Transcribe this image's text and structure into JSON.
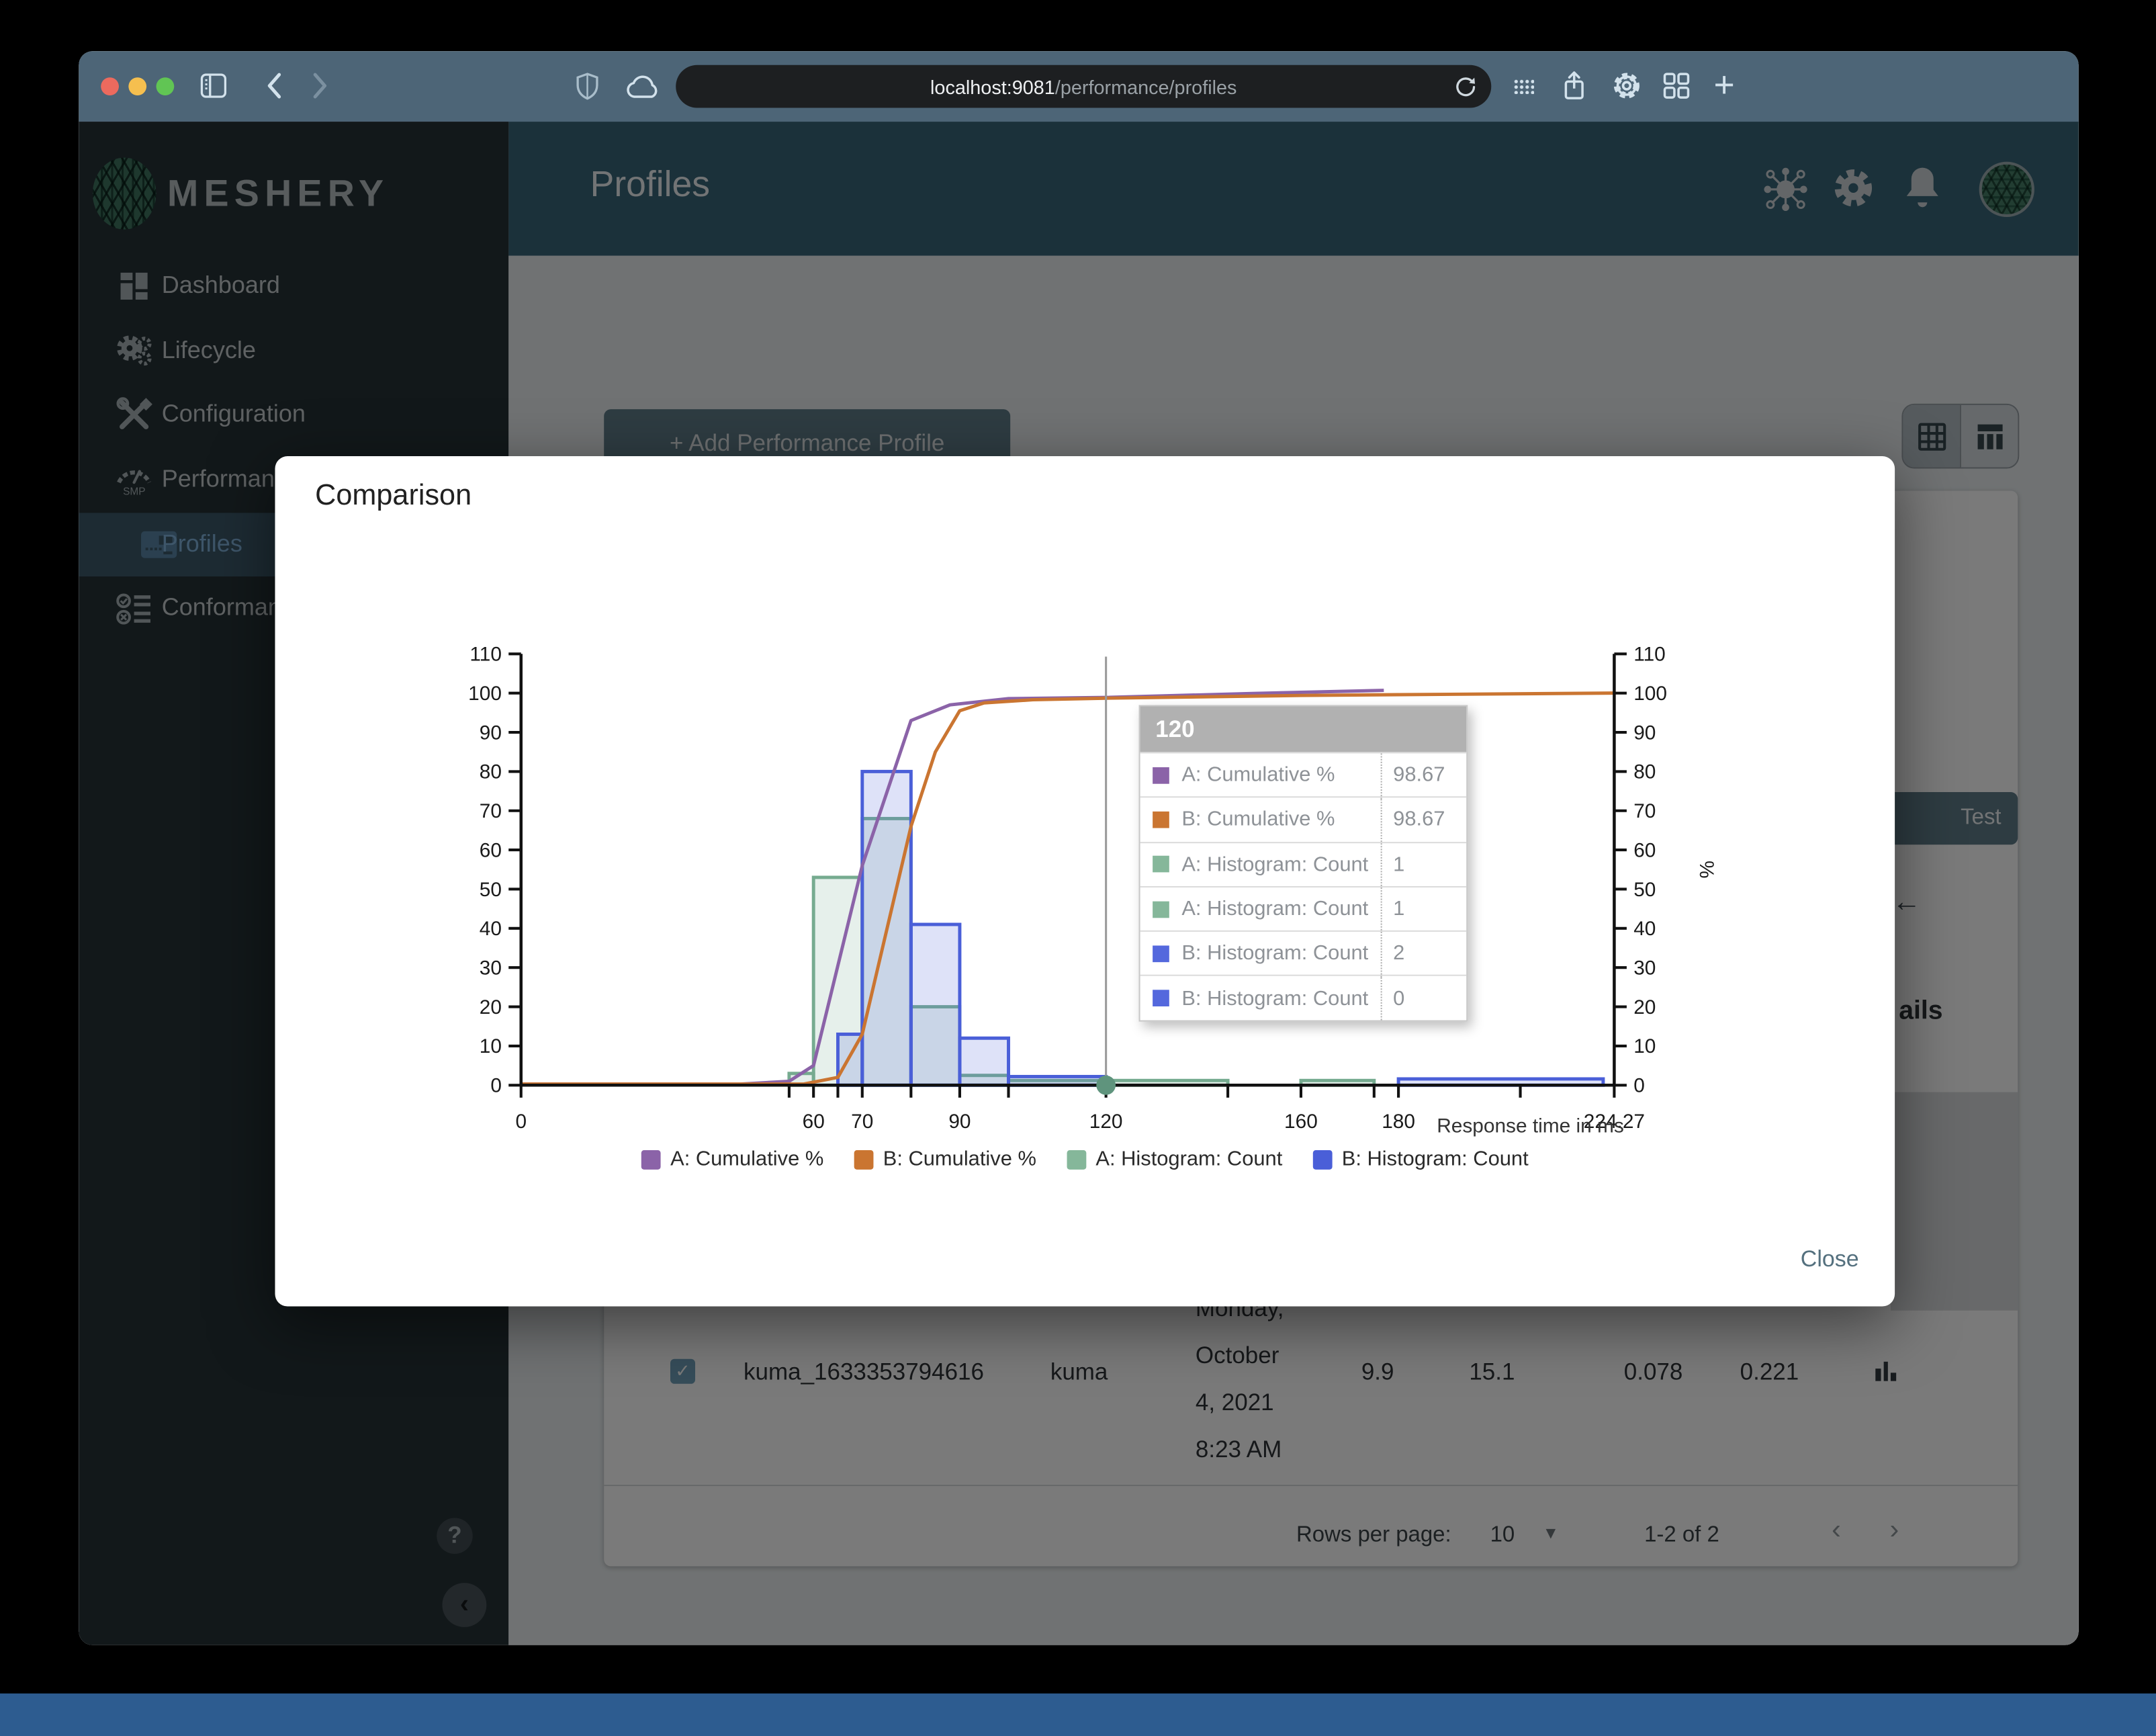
{
  "colors": {
    "toolbar": "#4d6577",
    "header": "#396679",
    "sidebar": "#263238",
    "accent_button": "#607d8b",
    "desktop": "#2d5c90",
    "traffic_red": "#ec6a5e",
    "traffic_yellow": "#f5bf4f",
    "traffic_green": "#61c554"
  },
  "browser": {
    "url_host": "localhost:9081",
    "url_path": "/performance/profiles"
  },
  "app": {
    "brand": "MESHERY",
    "header": {
      "title": "Profiles"
    },
    "sidebar": {
      "items": [
        {
          "label": "Dashboard"
        },
        {
          "label": "Lifecycle"
        },
        {
          "label": "Configuration"
        },
        {
          "label": "Performance"
        },
        {
          "label": "Profiles"
        },
        {
          "label": "Conformance"
        }
      ]
    },
    "content": {
      "add_button_label": "+ Add Performance Profile",
      "run_test_fragment_label": "Test",
      "details_fragment_label": "ails",
      "table_row": {
        "name": "kuma_1633353794616",
        "mesh": "kuma",
        "date_lines": [
          "Monday,",
          "October",
          "4, 2021",
          "8:23 AM"
        ],
        "metrics": [
          "9.9",
          "15.1",
          "0.078",
          "0.221"
        ]
      },
      "pagination": {
        "rows_label": "Rows per page:",
        "rows_value": "10",
        "range": "1-2 of 2"
      }
    }
  },
  "modal": {
    "title": "Comparison",
    "close_label": "Close"
  },
  "chart_data": {
    "type": "combo",
    "xlabel": "Response time in ms",
    "x_range": [
      0,
      224.27
    ],
    "y_left_range": [
      0,
      110
    ],
    "y_right_range": [
      0,
      110
    ],
    "y_right_label": "%",
    "y_ticks": [
      0,
      10,
      20,
      30,
      40,
      50,
      60,
      70,
      80,
      90,
      100,
      110
    ],
    "x_ticks_minor": [
      0,
      55,
      60,
      65,
      70,
      80,
      90,
      100,
      120,
      145,
      160,
      175,
      180,
      205,
      224.27
    ],
    "x_ticks_labeled": [
      {
        "v": 0,
        "s": "0"
      },
      {
        "v": 60,
        "s": "60"
      },
      {
        "v": 70,
        "s": "70"
      },
      {
        "v": 90,
        "s": "90"
      },
      {
        "v": 120,
        "s": "120"
      },
      {
        "v": 160,
        "s": "160"
      },
      {
        "v": 180,
        "s": "180"
      },
      {
        "v": 224.27,
        "s": "224.27"
      }
    ],
    "series": [
      {
        "name": "A: Cumulative %",
        "kind": "line",
        "color": "#8b63a8",
        "points": [
          [
            0,
            0.3
          ],
          [
            45,
            0.3
          ],
          [
            55,
            1
          ],
          [
            60,
            5
          ],
          [
            70,
            56
          ],
          [
            80,
            93
          ],
          [
            88,
            97
          ],
          [
            100,
            98.6
          ],
          [
            120,
            98.9
          ],
          [
            150,
            99.9
          ],
          [
            177,
            100.7
          ]
        ]
      },
      {
        "name": "B: Cumulative %",
        "kind": "line",
        "color": "#ca7531",
        "points": [
          [
            0,
            0.3
          ],
          [
            58,
            0.3
          ],
          [
            65,
            2
          ],
          [
            70,
            13
          ],
          [
            80,
            66
          ],
          [
            85,
            85
          ],
          [
            90,
            95.5
          ],
          [
            95,
            97.5
          ],
          [
            105,
            98.3
          ],
          [
            120,
            98.7
          ],
          [
            160,
            99.4
          ],
          [
            180,
            99.6
          ],
          [
            224.27,
            100
          ]
        ]
      },
      {
        "name": "A: Histogram: Count",
        "kind": "histogram",
        "color": "#76ab90",
        "bins": [
          [
            55,
            60,
            3
          ],
          [
            60,
            70,
            53
          ],
          [
            70,
            80,
            68
          ],
          [
            80,
            90,
            20
          ],
          [
            90,
            100,
            2.5
          ],
          [
            100,
            120,
            1.2
          ],
          [
            120,
            145,
            1.2
          ],
          [
            160,
            175,
            1.2
          ]
        ]
      },
      {
        "name": "B: Histogram: Count",
        "kind": "histogram",
        "color": "#4a5fd8",
        "bins": [
          [
            65,
            70,
            13
          ],
          [
            70,
            80,
            80
          ],
          [
            80,
            90,
            41
          ],
          [
            90,
            100,
            12
          ],
          [
            100,
            120,
            2.2
          ],
          [
            180,
            222,
            1.6
          ]
        ]
      }
    ],
    "crosshair": {
      "x": 120,
      "dot_color": "#5f947d"
    },
    "tooltip": {
      "title": "120",
      "rows": [
        {
          "color": "#8b63a8",
          "label": "A: Cumulative %",
          "value": "98.67"
        },
        {
          "color": "#ca7531",
          "label": "B: Cumulative %",
          "value": "98.67"
        },
        {
          "color": "#85b79a",
          "label": "A: Histogram: Count",
          "value": "1"
        },
        {
          "color": "#85b79a",
          "label": "A: Histogram: Count",
          "value": "1"
        },
        {
          "color": "#5468dd",
          "label": "B: Histogram: Count",
          "value": "2"
        },
        {
          "color": "#5468dd",
          "label": "B: Histogram: Count",
          "value": "0"
        }
      ]
    },
    "legend": [
      {
        "color": "#8b63a8",
        "label": "A: Cumulative %"
      },
      {
        "color": "#ca7531",
        "label": "B: Cumulative %"
      },
      {
        "color": "#85b79a",
        "label": "A: Histogram: Count"
      },
      {
        "color": "#4a5fd8",
        "label": "B: Histogram: Count"
      }
    ]
  }
}
